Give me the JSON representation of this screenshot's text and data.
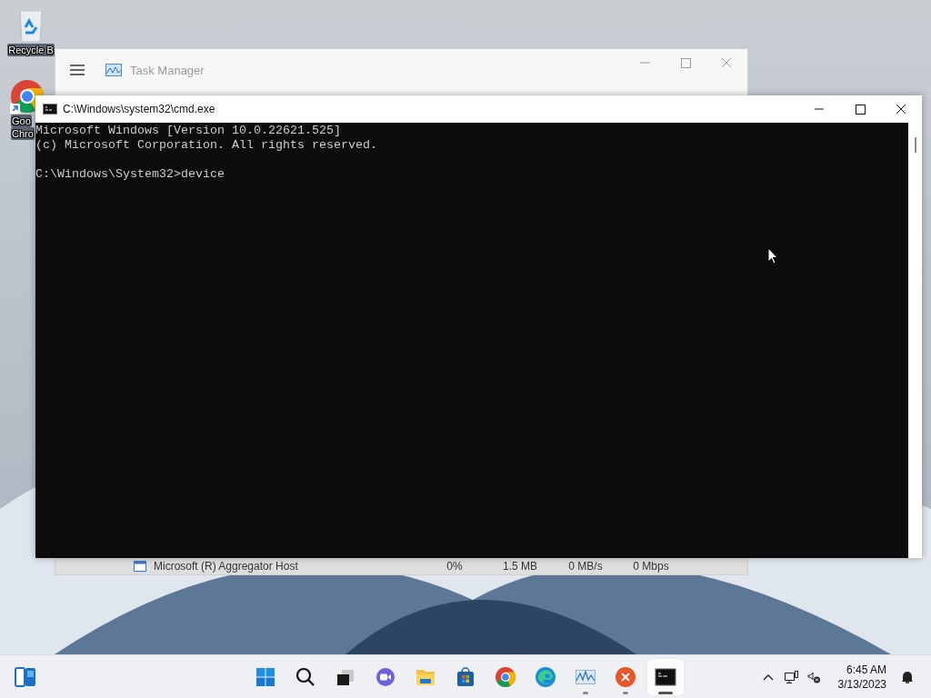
{
  "desktop_icons": [
    {
      "kind": "recycle-bin",
      "label_lines": [
        "Recycle B"
      ]
    },
    {
      "kind": "chrome",
      "label_lines": [
        "Goo",
        "Chro"
      ]
    }
  ],
  "task_manager": {
    "title": "Task Manager",
    "row": {
      "name": "Microsoft (R) Aggregator Host",
      "cpu": "0%",
      "memory": "1.5 MB",
      "disk": "0 MB/s",
      "network": "0 Mbps"
    }
  },
  "cmd_window": {
    "title": "C:\\Windows\\system32\\cmd.exe",
    "output": [
      "Microsoft Windows [Version 10.0.22621.525]",
      "(c) Microsoft Corporation. All rights reserved."
    ],
    "prompt": "C:\\Windows\\System32>device"
  },
  "taskbar": {
    "apps": [
      {
        "kind": "start",
        "running": false,
        "active": false
      },
      {
        "kind": "search",
        "running": false,
        "active": false
      },
      {
        "kind": "task-view",
        "running": false,
        "active": false
      },
      {
        "kind": "chat",
        "running": false,
        "active": false
      },
      {
        "kind": "explorer",
        "running": false,
        "active": false
      },
      {
        "kind": "store",
        "running": false,
        "active": false
      },
      {
        "kind": "chrome",
        "running": false,
        "active": false
      },
      {
        "kind": "edge",
        "running": false,
        "active": false
      },
      {
        "kind": "task-manager",
        "running": true,
        "active": false
      },
      {
        "kind": "x-app",
        "running": true,
        "active": false
      },
      {
        "kind": "terminal",
        "running": true,
        "active": true
      }
    ],
    "clock": {
      "time": "6:45 AM",
      "date": "3/13/2023"
    }
  }
}
